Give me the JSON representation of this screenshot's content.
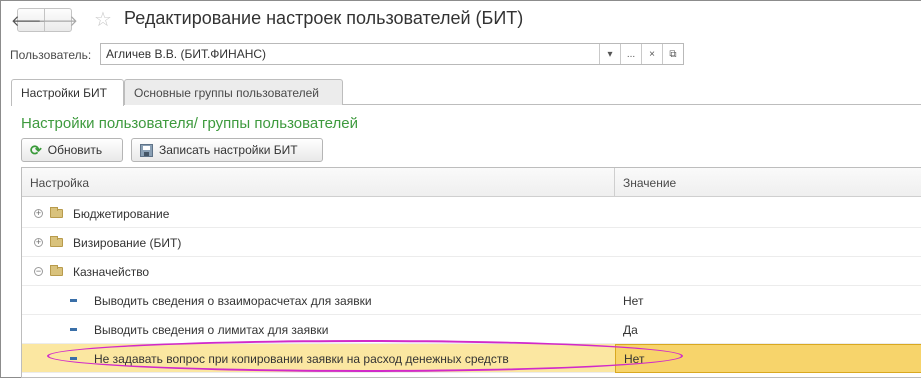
{
  "window": {
    "title": "Редактирование настроек пользователей (БИТ)",
    "back_icon": "arrow-left-icon",
    "forward_icon": "arrow-right-icon",
    "favorite_icon": "star-icon"
  },
  "user": {
    "label": "Пользователь:",
    "value": "Агличев В.В. (БИТ.ФИНАНС)",
    "dropdown_glyph": "▾",
    "select_glyph": "...",
    "clear_glyph": "×",
    "open_glyph": "⧉"
  },
  "tabs": [
    {
      "label": "Настройки БИТ",
      "active": true
    },
    {
      "label": "Основные группы пользователей",
      "active": false
    }
  ],
  "section_title": "Настройки пользователя/ группы пользователей",
  "toolbar": {
    "refresh_label": "Обновить",
    "save_label": "Записать настройки БИТ"
  },
  "table": {
    "columns": [
      "Настройка",
      "Значение"
    ],
    "rows": [
      {
        "type": "group",
        "expanded": false,
        "label": "Бюджетирование",
        "value": "",
        "expander": "+"
      },
      {
        "type": "group",
        "expanded": false,
        "label": "Визирование (БИТ)",
        "value": "",
        "expander": "+"
      },
      {
        "type": "group",
        "expanded": true,
        "label": "Казначейство",
        "value": "",
        "expander": "−"
      },
      {
        "type": "setting",
        "label": "Выводить сведения о взаиморасчетах для заявки",
        "value": "Нет"
      },
      {
        "type": "setting",
        "label": "Выводить сведения о лимитах для заявки",
        "value": "Да"
      },
      {
        "type": "setting",
        "label": "Не задавать вопрос при копировании заявки на расход денежных средств",
        "value": "Нет",
        "selected": true
      }
    ]
  },
  "colors": {
    "section_title": "#3e9a3e",
    "selected_row": "#fbe7a1",
    "selected_cell": "#f7d46b",
    "highlight_oval": "#d12ac9"
  }
}
